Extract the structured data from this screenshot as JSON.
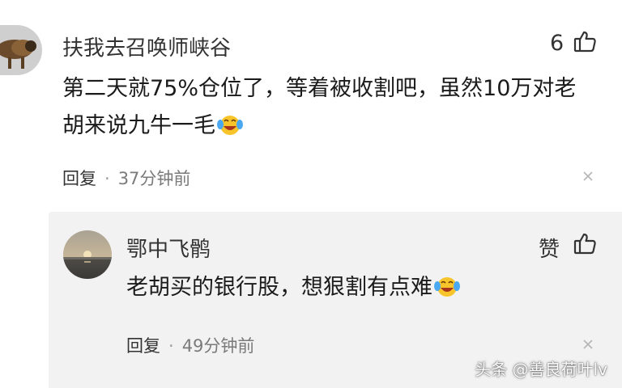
{
  "comment": {
    "author": "扶我去召唤师峡谷",
    "text": "第二天就75%仓位了，等着被收割吧，虽然10万对老胡来说九牛一毛",
    "emoji": "crying-laughing-emoji",
    "like_count": "6",
    "reply_label": "回复",
    "separator": "·",
    "time": "37分钟前"
  },
  "reply": {
    "author": "鄂中飞鹘",
    "text": "老胡买的银行股，想狠割有点难",
    "emoji": "crying-laughing-emoji",
    "like_label": "赞",
    "reply_label": "回复",
    "separator": "·",
    "time": "49分钟前"
  },
  "watermark": "头条 @善良荷叶lv",
  "colors": {
    "reply_background": "#f2f2f2",
    "emoji_face": "#f7c52b",
    "emoji_tears": "#4aa8f0"
  },
  "icons": [
    "thumbs-up-icon",
    "close-icon"
  ]
}
